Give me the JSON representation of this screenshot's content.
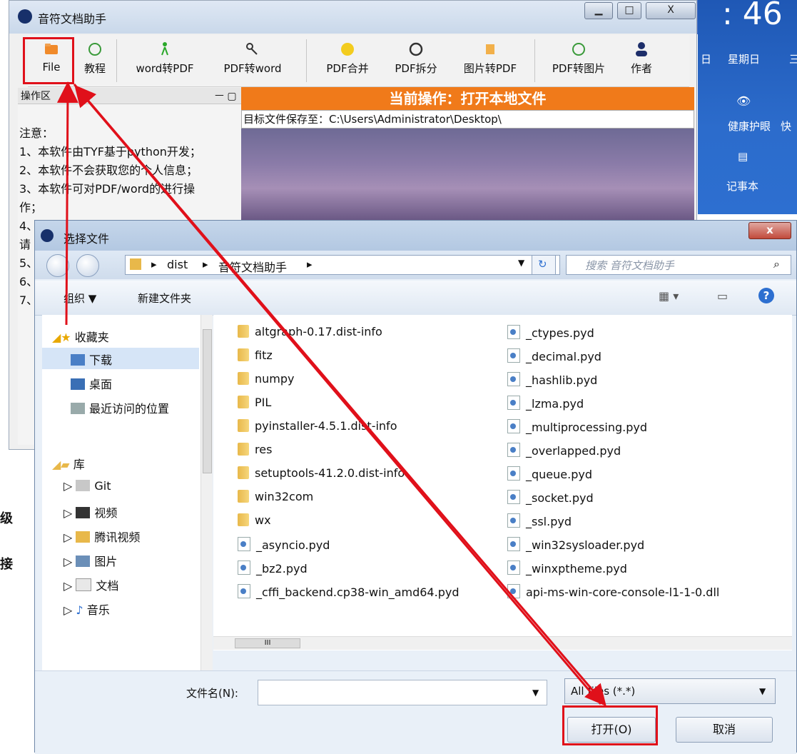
{
  "app": {
    "title": "音符文档助手",
    "controls": {
      "minimize": "▁",
      "maximize": "□",
      "close": "X"
    },
    "toolbar": [
      "File",
      "教程",
      "word转PDF",
      "PDF转word",
      "PDF合并",
      "PDF拆分",
      "图片转PDF",
      "PDF转图片",
      "作者"
    ],
    "op_panel_title": "操作区",
    "op_panel_controls": "ㅡ ▢",
    "notes": [
      "注意：",
      "1、本软件由TYF基于python开发；",
      "2、本软件不会获取您的个人信息；",
      "3、本软件可对PDF/word的进行操",
      "作；",
      "4、",
      "请",
      "5、",
      "6、",
      "7、"
    ],
    "current_operation": "当前操作：打开本地文件",
    "save_path": "目标文件保存至：C:\\Users\\Administrator\\Desktop\\"
  },
  "desktop": {
    "clock": ": 46",
    "day_prefix": "日",
    "weekday": "星期日",
    "weekday_suffix": "三",
    "eye_care": "健康护眼",
    "eye_care_suffix": "快",
    "eye_care_prefix": "",
    "notepad": "记事本",
    "stray_left_1": "级",
    "stray_left_2": "接"
  },
  "dialog": {
    "title": "选择文件",
    "close": "x",
    "path": [
      "dist",
      "音符文档助手"
    ],
    "search_placeholder": "搜索 音符文档助手",
    "organize": "组织 ▼",
    "new_folder": "新建文件夹",
    "nav": [
      "收藏夹",
      "下载",
      "桌面",
      "最近访问的位置",
      "库",
      "Git",
      "视频",
      "腾讯视频",
      "图片",
      "文档",
      "音乐"
    ],
    "files_col1": [
      "altgraph-0.17.dist-info",
      "fitz",
      "numpy",
      "PIL",
      "pyinstaller-4.5.1.dist-info",
      "res",
      "setuptools-41.2.0.dist-info",
      "win32com",
      "wx",
      "_asyncio.pyd",
      "_bz2.pyd",
      "_cffi_backend.cp38-win_amd64.pyd"
    ],
    "files_col2": [
      "_ctypes.pyd",
      "_decimal.pyd",
      "_hashlib.pyd",
      "_lzma.pyd",
      "_multiprocessing.pyd",
      "_overlapped.pyd",
      "_queue.pyd",
      "_socket.pyd",
      "_ssl.pyd",
      "_win32sysloader.pyd",
      "_winxptheme.pyd",
      "api-ms-win-core-console-l1-1-0.dll"
    ],
    "filename_label": "文件名(N):",
    "filetype": "All files (*.*)",
    "open": "打开(O)",
    "cancel": "取消",
    "hscroll_thumb": "III"
  },
  "colors": {
    "annotation": "#e0101a",
    "orange": "#f07a1a"
  }
}
